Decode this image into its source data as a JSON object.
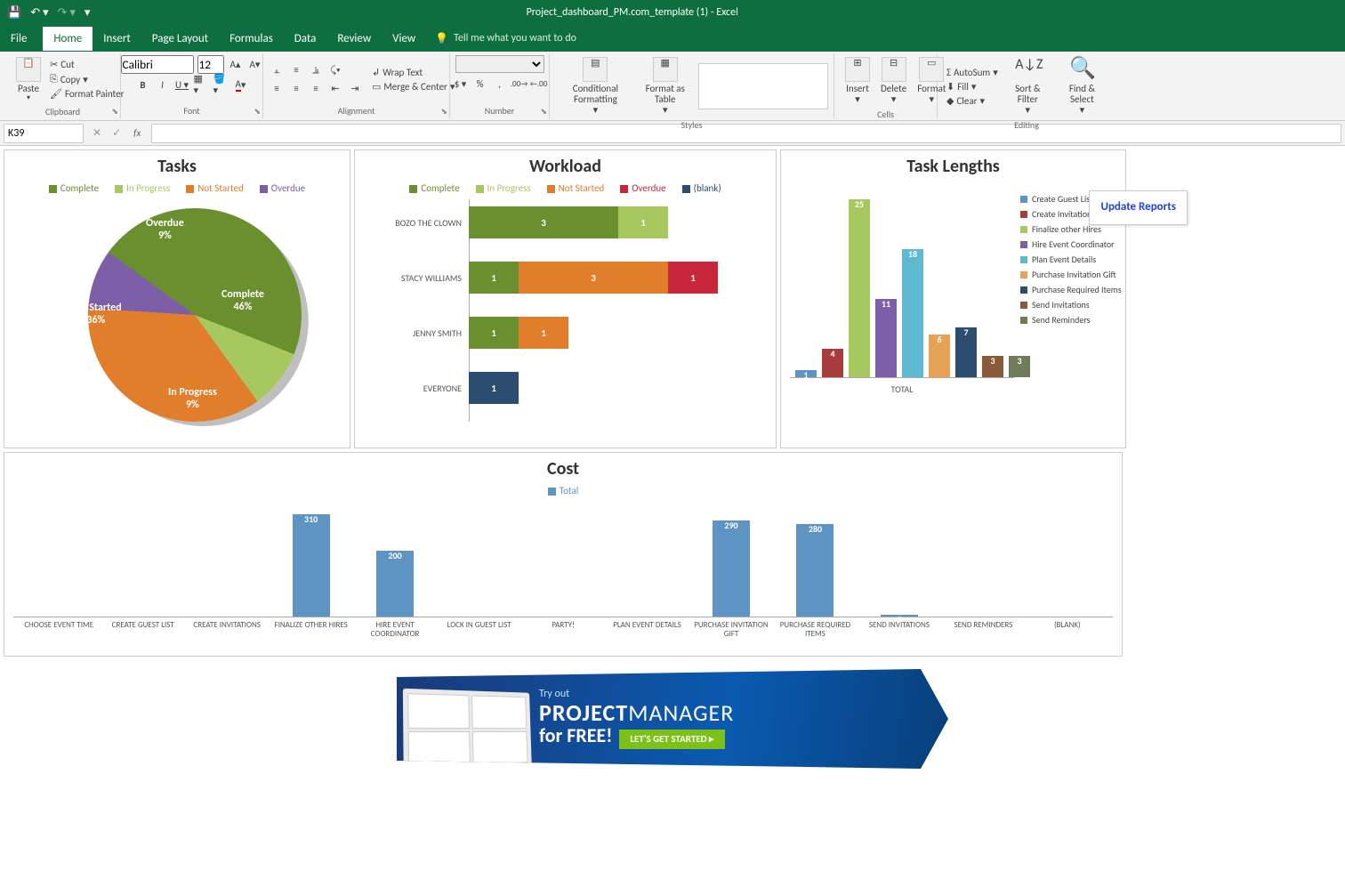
{
  "app": {
    "title": "Project_dashboard_PM.com_template (1) - Excel"
  },
  "qat": [
    "save-icon",
    "undo-icon",
    "redo-icon",
    "customize"
  ],
  "tabs": {
    "file": "File",
    "items": [
      "Home",
      "Insert",
      "Page Layout",
      "Formulas",
      "Data",
      "Review",
      "View"
    ],
    "active": "Home",
    "tellme_placeholder": "Tell me what you want to do"
  },
  "ribbon": {
    "clipboard": {
      "paste": "Paste",
      "cut": "Cut",
      "copy": "Copy",
      "format_painter": "Format Painter",
      "label": "Clipboard"
    },
    "font": {
      "name": "Calibri",
      "size": "12",
      "label": "Font"
    },
    "alignment": {
      "wrap": "Wrap Text",
      "merge": "Merge & Center",
      "label": "Alignment"
    },
    "number": {
      "label": "Number"
    },
    "styles": {
      "conditional": "Conditional Formatting",
      "format_table": "Format as Table",
      "label": "Styles"
    },
    "cells": {
      "insert": "Insert",
      "delete": "Delete",
      "format": "Format",
      "label": "Cells"
    },
    "editing": {
      "autosum": "AutoSum",
      "fill": "Fill",
      "clear": "Clear",
      "sort": "Sort & Filter",
      "find": "Find & Select",
      "label": "Editing"
    }
  },
  "formula_bar": {
    "cell_ref": "K39",
    "formula": ""
  },
  "dashboard": {
    "update_button": "Update Reports",
    "tasks": {
      "title": "Tasks",
      "legend": [
        "Complete",
        "In Progress",
        "Not Started",
        "Overdue"
      ],
      "slices": [
        {
          "label": "Complete",
          "pct": 46,
          "color": "#6a8f2f"
        },
        {
          "label": "In Progress",
          "pct": 9,
          "color": "#a7c85e"
        },
        {
          "label": "Not Started",
          "pct": 36,
          "color": "#e07e2b"
        },
        {
          "label": "Overdue",
          "pct": 9,
          "color": "#7d5fa8"
        }
      ]
    },
    "workload": {
      "title": "Workload",
      "legend": [
        "Complete",
        "In Progress",
        "Not Started",
        "Overdue",
        "(blank)"
      ],
      "rows": [
        {
          "name": "BOZO THE CLOWN",
          "segments": [
            {
              "v": 3,
              "c": "#6a8f2f"
            },
            {
              "v": 1,
              "c": "#a7c85e"
            }
          ]
        },
        {
          "name": "STACY WILLIAMS",
          "segments": [
            {
              "v": 1,
              "c": "#6a8f2f"
            },
            {
              "v": 3,
              "c": "#e07e2b"
            },
            {
              "v": 1,
              "c": "#c8273a"
            }
          ]
        },
        {
          "name": "JENNY SMITH",
          "segments": [
            {
              "v": 1,
              "c": "#6a8f2f"
            },
            {
              "v": 1,
              "c": "#e07e2b"
            }
          ]
        },
        {
          "name": "EVERYONE",
          "segments": [
            {
              "v": 1,
              "c": "#2b4d6f"
            }
          ]
        }
      ]
    },
    "lengths": {
      "title": "Task Lengths",
      "xlabel": "TOTAL",
      "series": [
        {
          "name": "Create Guest List",
          "value": 1,
          "color": "#5e94c3"
        },
        {
          "name": "Create Invitations",
          "value": 4,
          "color": "#a83b3b"
        },
        {
          "name": "Finalize other Hires",
          "value": 25,
          "color": "#a7c85e"
        },
        {
          "name": "Hire Event Coordinator",
          "value": 11,
          "color": "#7d5fa8"
        },
        {
          "name": "Plan Event Details",
          "value": 18,
          "color": "#5fbad1"
        },
        {
          "name": "Purchase Invitation Gift",
          "value": 6,
          "color": "#e6a356"
        },
        {
          "name": "Purchase Required Items",
          "value": 7,
          "color": "#2b4d6f"
        },
        {
          "name": "Send Invitations",
          "value": 3,
          "color": "#8a5a3a"
        },
        {
          "name": "Send Reminders",
          "value": 3,
          "color": "#6f7c5a"
        }
      ]
    },
    "cost": {
      "title": "Cost",
      "legend": "Total",
      "items": [
        {
          "name": "CHOOSE EVENT TIME",
          "value": 0
        },
        {
          "name": "CREATE GUEST LIST",
          "value": 0
        },
        {
          "name": "CREATE INVITATIONS",
          "value": 0
        },
        {
          "name": "FINALIZE OTHER HIRES",
          "value": 310
        },
        {
          "name": "HIRE EVENT COORDINATOR",
          "value": 200
        },
        {
          "name": "LOCK IN GUEST LIST",
          "value": 0
        },
        {
          "name": "PARTY!",
          "value": 0
        },
        {
          "name": "PLAN EVENT DETAILS",
          "value": 0
        },
        {
          "name": "PURCHASE INVITATION GIFT",
          "value": 290
        },
        {
          "name": "PURCHASE REQUIRED ITEMS",
          "value": 280
        },
        {
          "name": "SEND INVITATIONS",
          "value": 5
        },
        {
          "name": "SEND REMINDERS",
          "value": 0
        },
        {
          "name": "(BLANK)",
          "value": 0
        }
      ]
    }
  },
  "banner": {
    "tryout": "Try out",
    "brand1": "PROJECT",
    "brand2": "MANAGER",
    "free": "for FREE!",
    "cta": "LET'S GET STARTED ▸"
  },
  "chart_data": [
    {
      "type": "pie",
      "title": "Tasks",
      "categories": [
        "Complete",
        "In Progress",
        "Not Started",
        "Overdue"
      ],
      "values": [
        46,
        9,
        36,
        9
      ],
      "unit": "%"
    },
    {
      "type": "bar",
      "orientation": "horizontal",
      "stacked": true,
      "title": "Workload",
      "categories": [
        "BOZO THE CLOWN",
        "STACY WILLIAMS",
        "JENNY SMITH",
        "EVERYONE"
      ],
      "series": [
        {
          "name": "Complete",
          "values": [
            3,
            1,
            1,
            0
          ]
        },
        {
          "name": "In Progress",
          "values": [
            1,
            0,
            0,
            0
          ]
        },
        {
          "name": "Not Started",
          "values": [
            0,
            3,
            1,
            0
          ]
        },
        {
          "name": "Overdue",
          "values": [
            0,
            1,
            0,
            0
          ]
        },
        {
          "name": "(blank)",
          "values": [
            0,
            0,
            0,
            1
          ]
        }
      ],
      "xlabel": "",
      "ylabel": ""
    },
    {
      "type": "bar",
      "title": "Task Lengths",
      "categories": [
        "Create Guest List",
        "Create Invitations",
        "Finalize other Hires",
        "Hire Event Coordinator",
        "Plan Event Details",
        "Purchase Invitation Gift",
        "Purchase Required Items",
        "Send Invitations",
        "Send Reminders"
      ],
      "values": [
        1,
        4,
        25,
        11,
        18,
        6,
        7,
        3,
        3
      ],
      "xlabel": "TOTAL",
      "ylabel": "",
      "ylim": [
        0,
        25
      ]
    },
    {
      "type": "bar",
      "title": "Cost",
      "legend": [
        "Total"
      ],
      "categories": [
        "CHOOSE EVENT TIME",
        "CREATE GUEST LIST",
        "CREATE INVITATIONS",
        "FINALIZE OTHER HIRES",
        "HIRE EVENT COORDINATOR",
        "LOCK IN GUEST LIST",
        "PARTY!",
        "PLAN EVENT DETAILS",
        "PURCHASE INVITATION GIFT",
        "PURCHASE REQUIRED ITEMS",
        "SEND INVITATIONS",
        "SEND REMINDERS",
        "(BLANK)"
      ],
      "values": [
        0,
        0,
        0,
        310,
        200,
        0,
        0,
        0,
        290,
        280,
        5,
        0,
        0
      ],
      "ylim": [
        0,
        320
      ]
    }
  ]
}
